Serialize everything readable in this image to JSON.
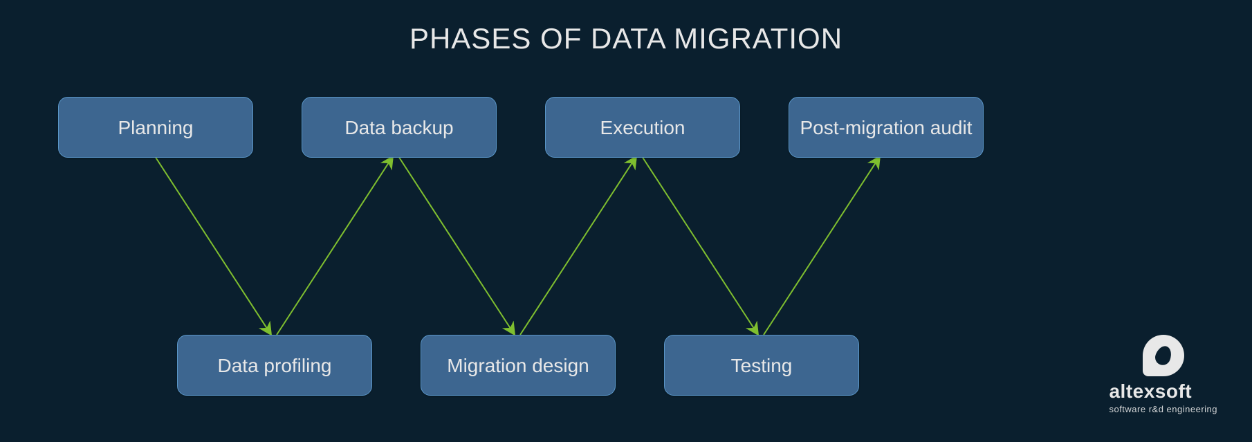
{
  "title": "PHASES OF DATA MIGRATION",
  "nodes": {
    "n1": "Planning",
    "n2": "Data profiling",
    "n3": "Data backup",
    "n4": "Migration design",
    "n5": "Execution",
    "n6": "Testing",
    "n7": "Post-migration audit"
  },
  "logo": {
    "name": "altexsoft",
    "tagline": "software r&d engineering"
  },
  "colors": {
    "bg": "#0a1f2e",
    "node": "#3d6690",
    "nodeBorder": "#5a96c8",
    "arrow": "#7fbf2f",
    "text": "#e8e8e8"
  }
}
